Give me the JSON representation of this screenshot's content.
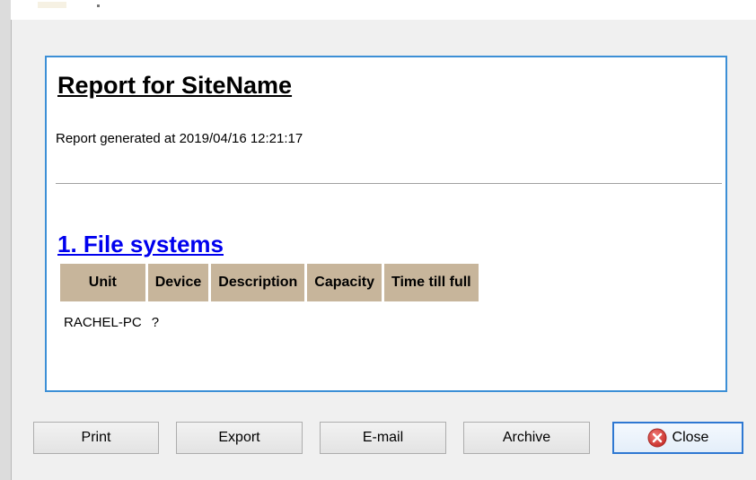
{
  "report": {
    "title": "Report for SiteName",
    "generated": "Report generated at 2019/04/16 12:21:17"
  },
  "section": {
    "heading": "1. File systems",
    "columns": [
      "Unit",
      "Device",
      "Description",
      "Capacity",
      "Time till full"
    ],
    "rows": [
      [
        "RACHEL-PC",
        "?",
        "",
        "",
        ""
      ]
    ]
  },
  "buttons": {
    "print": "Print",
    "export": "Export",
    "email": "E-mail",
    "archive": "Archive",
    "close": "Close"
  },
  "colors": {
    "frame_border": "#3c8fd6",
    "header_bg": "#c7b59b",
    "link": "#0000ee",
    "close_icon": "#d9534f"
  },
  "icons": {
    "close": "close-icon"
  }
}
